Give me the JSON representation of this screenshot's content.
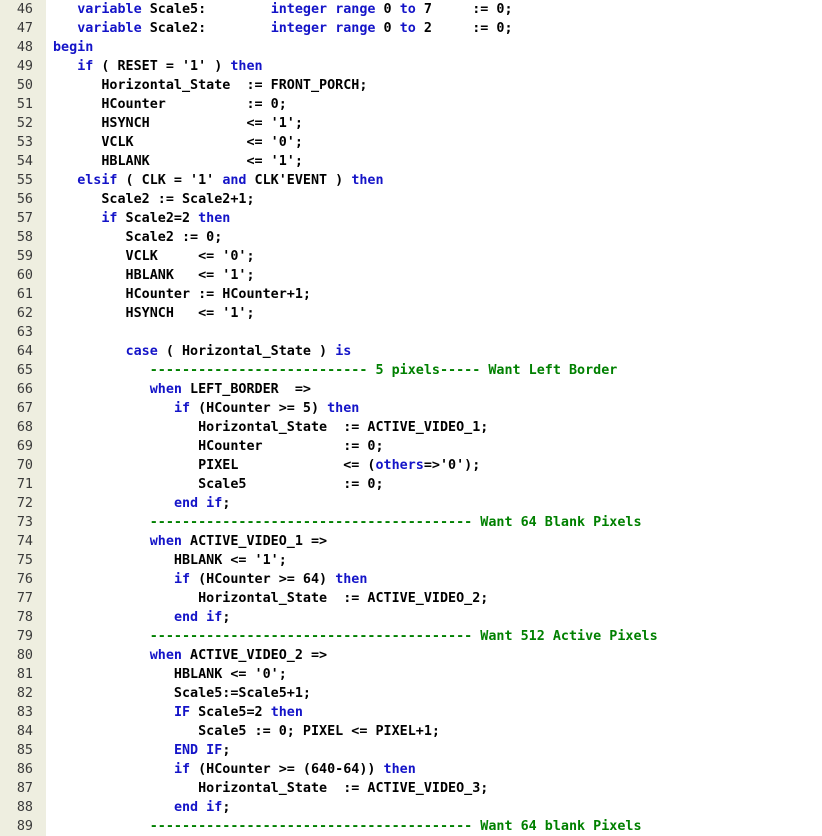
{
  "editor": {
    "colors": {
      "gutter": "#eeeee0",
      "line_number": "#3a3a3a",
      "text": "#000000",
      "keyword": "#1414c8",
      "comment": "#008000"
    },
    "lines": [
      {
        "num": "46",
        "tokens": [
          [
            "t",
            "   "
          ],
          [
            "k",
            "variable"
          ],
          [
            "t",
            " Scale5:        "
          ],
          [
            "k",
            "integer"
          ],
          [
            "t",
            " "
          ],
          [
            "k",
            "range"
          ],
          [
            "t",
            " 0 "
          ],
          [
            "k",
            "to"
          ],
          [
            "t",
            " 7     := 0;"
          ]
        ]
      },
      {
        "num": "47",
        "tokens": [
          [
            "t",
            "   "
          ],
          [
            "k",
            "variable"
          ],
          [
            "t",
            " Scale2:        "
          ],
          [
            "k",
            "integer"
          ],
          [
            "t",
            " "
          ],
          [
            "k",
            "range"
          ],
          [
            "t",
            " 0 "
          ],
          [
            "k",
            "to"
          ],
          [
            "t",
            " 2     := 0;"
          ]
        ]
      },
      {
        "num": "48",
        "tokens": [
          [
            "k",
            "begin"
          ]
        ]
      },
      {
        "num": "49",
        "tokens": [
          [
            "t",
            "   "
          ],
          [
            "k",
            "if"
          ],
          [
            "t",
            " ( RESET = '1' ) "
          ],
          [
            "k",
            "then"
          ]
        ]
      },
      {
        "num": "50",
        "tokens": [
          [
            "t",
            "      Horizontal_State  := FRONT_PORCH;"
          ]
        ]
      },
      {
        "num": "51",
        "tokens": [
          [
            "t",
            "      HCounter          := 0;"
          ]
        ]
      },
      {
        "num": "52",
        "tokens": [
          [
            "t",
            "      HSYNCH            <= '1';"
          ]
        ]
      },
      {
        "num": "53",
        "tokens": [
          [
            "t",
            "      VCLK              <= '0';"
          ]
        ]
      },
      {
        "num": "54",
        "tokens": [
          [
            "t",
            "      HBLANK            <= '1';"
          ]
        ]
      },
      {
        "num": "55",
        "tokens": [
          [
            "t",
            "   "
          ],
          [
            "k",
            "elsif"
          ],
          [
            "t",
            " ( CLK = '1' "
          ],
          [
            "k",
            "and"
          ],
          [
            "t",
            " CLK'EVENT ) "
          ],
          [
            "k",
            "then"
          ]
        ]
      },
      {
        "num": "56",
        "tokens": [
          [
            "t",
            "      Scale2 := Scale2+1;"
          ]
        ]
      },
      {
        "num": "57",
        "tokens": [
          [
            "t",
            "      "
          ],
          [
            "k",
            "if"
          ],
          [
            "t",
            " Scale2=2 "
          ],
          [
            "k",
            "then"
          ]
        ]
      },
      {
        "num": "58",
        "tokens": [
          [
            "t",
            "         Scale2 := 0;"
          ]
        ]
      },
      {
        "num": "59",
        "tokens": [
          [
            "t",
            "         VCLK     <= '0';"
          ]
        ]
      },
      {
        "num": "60",
        "tokens": [
          [
            "t",
            "         HBLANK   <= '1';"
          ]
        ]
      },
      {
        "num": "61",
        "tokens": [
          [
            "t",
            "         HCounter := HCounter+1;"
          ]
        ]
      },
      {
        "num": "62",
        "tokens": [
          [
            "t",
            "         HSYNCH   <= '1';"
          ]
        ]
      },
      {
        "num": "63",
        "tokens": []
      },
      {
        "num": "64",
        "tokens": [
          [
            "t",
            "         "
          ],
          [
            "k",
            "case"
          ],
          [
            "t",
            " ( Horizontal_State ) "
          ],
          [
            "k",
            "is"
          ]
        ]
      },
      {
        "num": "65",
        "tokens": [
          [
            "t",
            "            "
          ],
          [
            "c",
            "--------------------------- 5 pixels----- Want Left Border"
          ]
        ]
      },
      {
        "num": "66",
        "tokens": [
          [
            "t",
            "            "
          ],
          [
            "k",
            "when"
          ],
          [
            "t",
            " LEFT_BORDER  =>"
          ]
        ]
      },
      {
        "num": "67",
        "tokens": [
          [
            "t",
            "               "
          ],
          [
            "k",
            "if"
          ],
          [
            "t",
            " (HCounter >= 5) "
          ],
          [
            "k",
            "then"
          ]
        ]
      },
      {
        "num": "68",
        "tokens": [
          [
            "t",
            "                  Horizontal_State  := ACTIVE_VIDEO_1;"
          ]
        ]
      },
      {
        "num": "69",
        "tokens": [
          [
            "t",
            "                  HCounter          := 0;"
          ]
        ]
      },
      {
        "num": "70",
        "tokens": [
          [
            "t",
            "                  PIXEL             <= ("
          ],
          [
            "k",
            "others"
          ],
          [
            "t",
            "=>'0');"
          ]
        ]
      },
      {
        "num": "71",
        "tokens": [
          [
            "t",
            "                  Scale5            := 0;"
          ]
        ]
      },
      {
        "num": "72",
        "tokens": [
          [
            "t",
            "               "
          ],
          [
            "k",
            "end if"
          ],
          [
            "t",
            ";"
          ]
        ]
      },
      {
        "num": "73",
        "tokens": [
          [
            "t",
            "            "
          ],
          [
            "c",
            "---------------------------------------- Want 64 Blank Pixels"
          ]
        ]
      },
      {
        "num": "74",
        "tokens": [
          [
            "t",
            "            "
          ],
          [
            "k",
            "when"
          ],
          [
            "t",
            " ACTIVE_VIDEO_1 =>"
          ]
        ]
      },
      {
        "num": "75",
        "tokens": [
          [
            "t",
            "               HBLANK <= '1';"
          ]
        ]
      },
      {
        "num": "76",
        "tokens": [
          [
            "t",
            "               "
          ],
          [
            "k",
            "if"
          ],
          [
            "t",
            " (HCounter >= 64) "
          ],
          [
            "k",
            "then"
          ]
        ]
      },
      {
        "num": "77",
        "tokens": [
          [
            "t",
            "                  Horizontal_State  := ACTIVE_VIDEO_2;"
          ]
        ]
      },
      {
        "num": "78",
        "tokens": [
          [
            "t",
            "               "
          ],
          [
            "k",
            "end if"
          ],
          [
            "t",
            ";"
          ]
        ]
      },
      {
        "num": "79",
        "tokens": [
          [
            "t",
            "            "
          ],
          [
            "c",
            "---------------------------------------- Want 512 Active Pixels"
          ]
        ]
      },
      {
        "num": "80",
        "tokens": [
          [
            "t",
            "            "
          ],
          [
            "k",
            "when"
          ],
          [
            "t",
            " ACTIVE_VIDEO_2 =>"
          ]
        ]
      },
      {
        "num": "81",
        "tokens": [
          [
            "t",
            "               HBLANK <= '0';"
          ]
        ]
      },
      {
        "num": "82",
        "tokens": [
          [
            "t",
            "               Scale5:=Scale5+1;"
          ]
        ]
      },
      {
        "num": "83",
        "tokens": [
          [
            "t",
            "               "
          ],
          [
            "k",
            "IF"
          ],
          [
            "t",
            " Scale5=2 "
          ],
          [
            "k",
            "then"
          ]
        ]
      },
      {
        "num": "84",
        "tokens": [
          [
            "t",
            "                  Scale5 := 0; PIXEL <= PIXEL+1;"
          ]
        ]
      },
      {
        "num": "85",
        "tokens": [
          [
            "t",
            "               "
          ],
          [
            "k",
            "END IF"
          ],
          [
            "t",
            ";"
          ]
        ]
      },
      {
        "num": "86",
        "tokens": [
          [
            "t",
            "               "
          ],
          [
            "k",
            "if"
          ],
          [
            "t",
            " (HCounter >= (640-64)) "
          ],
          [
            "k",
            "then"
          ]
        ]
      },
      {
        "num": "87",
        "tokens": [
          [
            "t",
            "                  Horizontal_State  := ACTIVE_VIDEO_3;"
          ]
        ]
      },
      {
        "num": "88",
        "tokens": [
          [
            "t",
            "               "
          ],
          [
            "k",
            "end if"
          ],
          [
            "t",
            ";"
          ]
        ]
      },
      {
        "num": "89",
        "tokens": [
          [
            "t",
            "            "
          ],
          [
            "c",
            "---------------------------------------- Want 64 blank Pixels"
          ]
        ]
      }
    ]
  }
}
